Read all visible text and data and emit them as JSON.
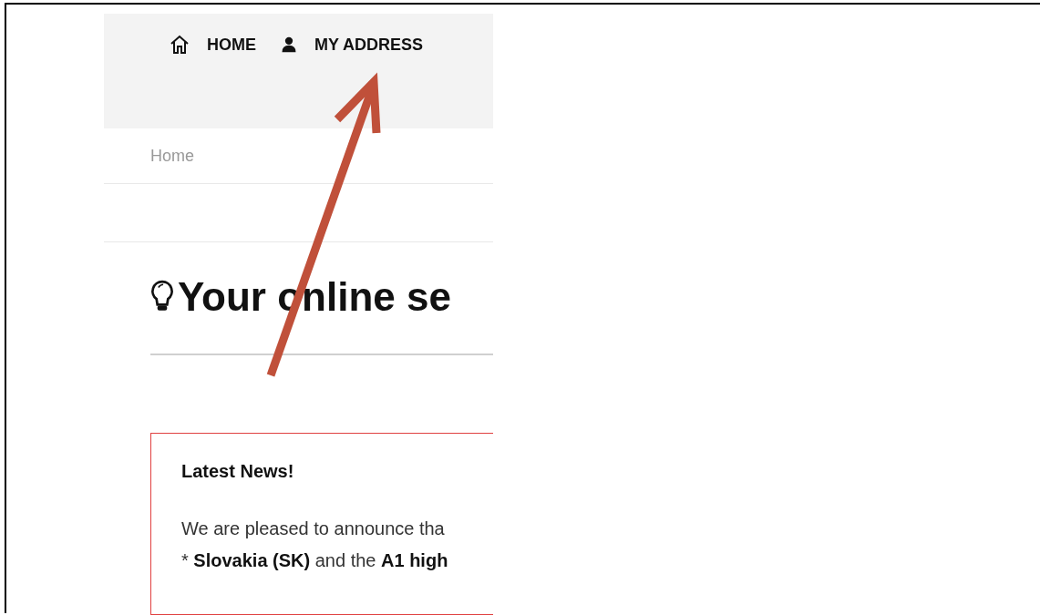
{
  "nav": [
    {
      "label": "HOME"
    },
    {
      "label": "MY ADDRESS"
    }
  ],
  "breadcrumb": [
    "Home"
  ],
  "heading": {
    "text": "Your online se"
  },
  "news": {
    "title": "Latest News!",
    "lines": [
      "We are pleased to announce tha",
      "* **Slovakia (SK)** and the **A1 high**"
    ]
  }
}
